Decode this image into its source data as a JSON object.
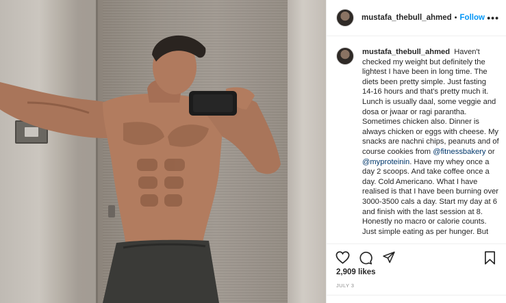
{
  "post": {
    "username": "mustafa_thebull_ahmed",
    "separator": "•",
    "follow_label": "Follow",
    "more_label": "•••",
    "caption_user": "mustafa_thebull_ahmed",
    "caption_part1": "Haven't checked my weight but definitely the lightest I have been in long time. The diets been pretty simple. Just fasting 14-16 hours and that's pretty much it. Lunch is usually daal, some veggie and dosa or jwaar or ragi parantha. Sometimes chicken also. Dinner is always chicken or eggs with cheese. My snacks are nachni chips, peanuts and of course cookies from ",
    "mention1": "@fitnessbakery",
    "caption_or": " or ",
    "mention2": "@myproteinin",
    "caption_part2": ". Have my whey once a day 2 scoops. And take coffee once a day. Cold Americano. What I have realised is that I have been burning over 3000-3500 cals a day. Start my day at 6 and finish with the last session at 8. Honestly no macro or calorie counts. Just simple eating as per hunger. But",
    "likes": "2,909 likes",
    "date": "JULY 3"
  },
  "icons": {
    "like": "heart-icon",
    "comment": "comment-icon",
    "share": "paper-plane-icon",
    "save": "bookmark-icon"
  },
  "colors": {
    "link": "#0095f6",
    "mention": "#00376b",
    "muted": "#8e8e8e",
    "text": "#262626"
  }
}
